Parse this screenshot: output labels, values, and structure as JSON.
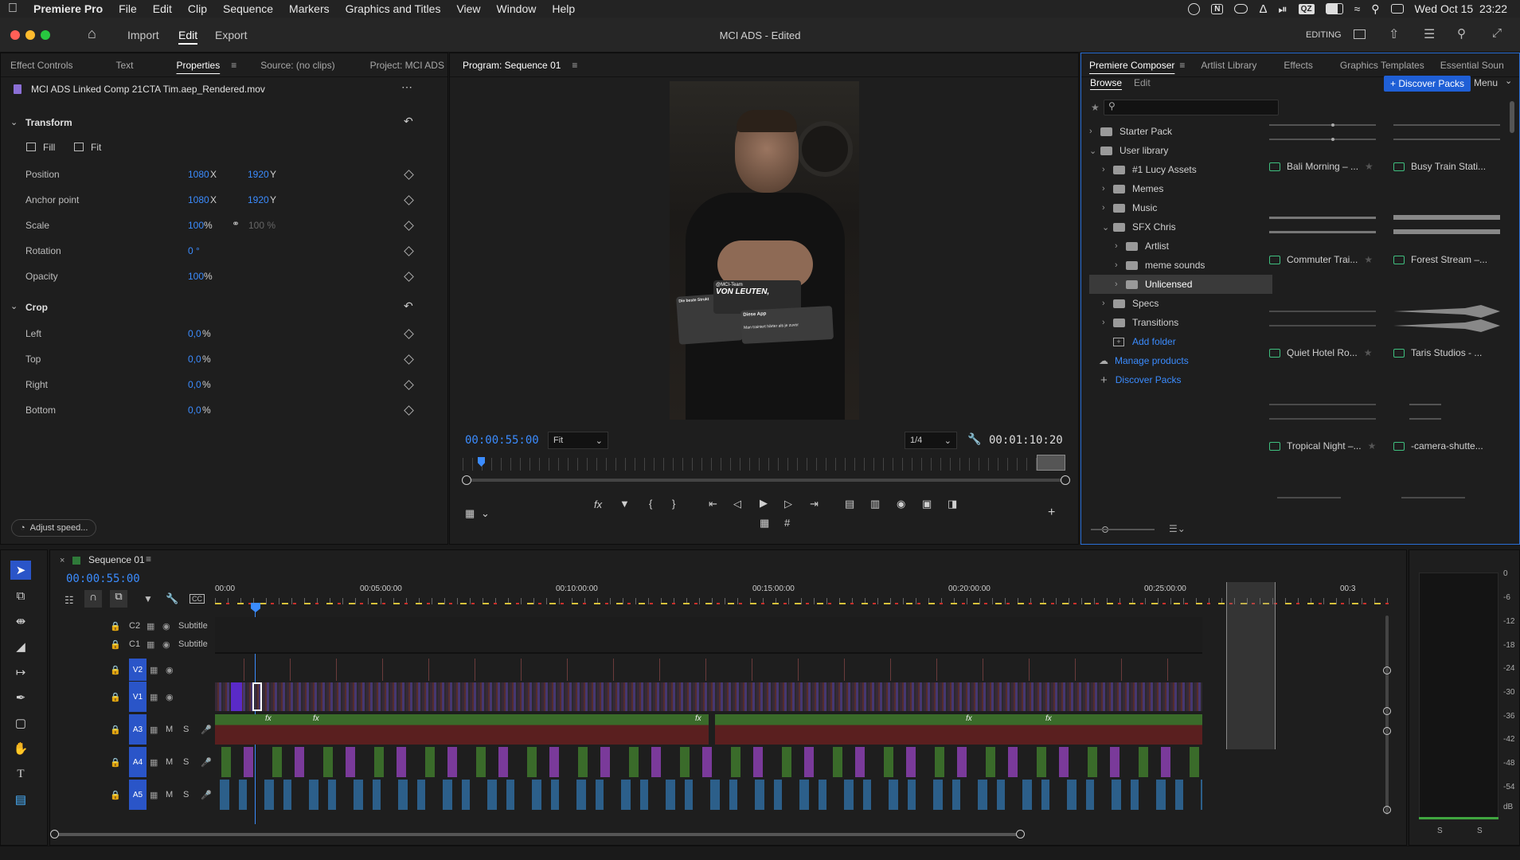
{
  "menubar": {
    "app": "Premiere Pro",
    "items": [
      "File",
      "Edit",
      "Clip",
      "Sequence",
      "Markers",
      "Graphics and Titles",
      "View",
      "Window",
      "Help"
    ],
    "clock": "Wed Oct 15  23:22",
    "qz_badge": "QZ",
    "n_badge": "N"
  },
  "titlebar": {
    "nav": [
      "Import",
      "Edit",
      "Export"
    ],
    "active_nav": "Edit",
    "title": "MCI ADS - Edited",
    "workspace": "EDITING"
  },
  "left_panel": {
    "tabs": [
      "Effect Controls",
      "Text",
      "Properties",
      "Source: (no clips)",
      "Project: MCI ADS"
    ],
    "active_tab": "Properties",
    "clip_name": "MCI ADS Linked Comp 21CTA Tim.aep_Rendered.mov",
    "transform": {
      "title": "Transform",
      "fill_label": "Fill",
      "fit_label": "Fit",
      "position": {
        "label": "Position",
        "x": "1080",
        "y": "1920"
      },
      "anchor": {
        "label": "Anchor point",
        "x": "1080",
        "y": "1920"
      },
      "scale": {
        "label": "Scale",
        "value": "100",
        "unit": "%",
        "linked": "100 %"
      },
      "rotation": {
        "label": "Rotation",
        "value": "0 °"
      },
      "opacity": {
        "label": "Opacity",
        "value": "100",
        "unit": "%"
      }
    },
    "crop": {
      "title": "Crop",
      "left": {
        "label": "Left",
        "value": "0,0",
        "unit": "%"
      },
      "top": {
        "label": "Top",
        "value": "0,0",
        "unit": "%"
      },
      "right": {
        "label": "Right",
        "value": "0,0",
        "unit": "%"
      },
      "bottom": {
        "label": "Bottom",
        "value": "0,0",
        "unit": "%"
      }
    },
    "adjust_speed": "Adjust speed..."
  },
  "program": {
    "tab": "Program: Sequence 01",
    "timecode": "00:00:55:00",
    "fit": "Fit",
    "quality": "1/4",
    "duration": "00:01:10:20",
    "overlay": {
      "handle": "@MCI-Team",
      "headline": "VON LEUTEN,",
      "card_left": "Die beste Strukt",
      "card_right": "Diese App",
      "quote": "Man trainiert härter als je zuvor"
    }
  },
  "composer": {
    "tabs": [
      "Premiere Composer",
      "Artlist Library",
      "Effects",
      "Graphics Templates",
      "Essential Soun"
    ],
    "active_tab": "Premiere Composer",
    "subtabs": [
      "Browse",
      "Edit"
    ],
    "discover_button": "+ Discover Packs",
    "menu": "Menu",
    "tree": [
      {
        "label": "Starter Pack",
        "depth": 0,
        "open": false
      },
      {
        "label": "User library",
        "depth": 0,
        "open": true
      },
      {
        "label": "#1 Lucy Assets",
        "depth": 1,
        "open": false
      },
      {
        "label": "Memes",
        "depth": 1,
        "open": false
      },
      {
        "label": "Music",
        "depth": 1,
        "open": false
      },
      {
        "label": "SFX Chris",
        "depth": 1,
        "open": true
      },
      {
        "label": "Artlist",
        "depth": 2,
        "open": false
      },
      {
        "label": "meme sounds",
        "depth": 2,
        "open": false
      },
      {
        "label": "Unlicensed",
        "depth": 2,
        "open": false,
        "selected": true
      },
      {
        "label": "Specs",
        "depth": 1,
        "open": false
      },
      {
        "label": "Transitions",
        "depth": 1,
        "open": false
      }
    ],
    "add_folder": "Add folder",
    "manage_products": "Manage products",
    "discover_packs": "Discover Packs",
    "clips": [
      "Bali Morning – ...",
      "Busy Train Stati...",
      "Commuter Trai...",
      "Forest Stream –...",
      "Quiet Hotel Ro...",
      "Taris Studios - ...",
      "Tropical Night –...",
      "-camera-shutte..."
    ]
  },
  "timeline": {
    "tab": "Sequence 01",
    "timecode": "00:00:55:00",
    "ruler": [
      "00:00",
      "00:05:00:00",
      "00:10:00:00",
      "00:15:00:00",
      "00:20:00:00",
      "00:25:00:00",
      "00:3"
    ],
    "tracks": [
      {
        "id": "C2",
        "name": "Subtitle"
      },
      {
        "id": "C1",
        "name": "Subtitle"
      },
      {
        "id": "V2",
        "name": ""
      },
      {
        "id": "V1",
        "name": ""
      },
      {
        "id": "A3",
        "name": ""
      },
      {
        "id": "A4",
        "name": ""
      },
      {
        "id": "A5",
        "name": ""
      }
    ],
    "m_label": "M",
    "s_label": "S",
    "fx_label": "fx"
  },
  "meter": {
    "scale": [
      "0",
      "-6",
      "-12",
      "-18",
      "-24",
      "-30",
      "-36",
      "-42",
      "-48",
      "-54",
      "dB"
    ],
    "channels": [
      "S",
      "S"
    ]
  },
  "colors": {
    "accent": "#3b8cff",
    "video_clip": "#4a3a7a",
    "audio_clip_green": "#3a6b2a",
    "audio_clip_red": "#7a2a2a",
    "track_badge": "#2a55c8"
  }
}
